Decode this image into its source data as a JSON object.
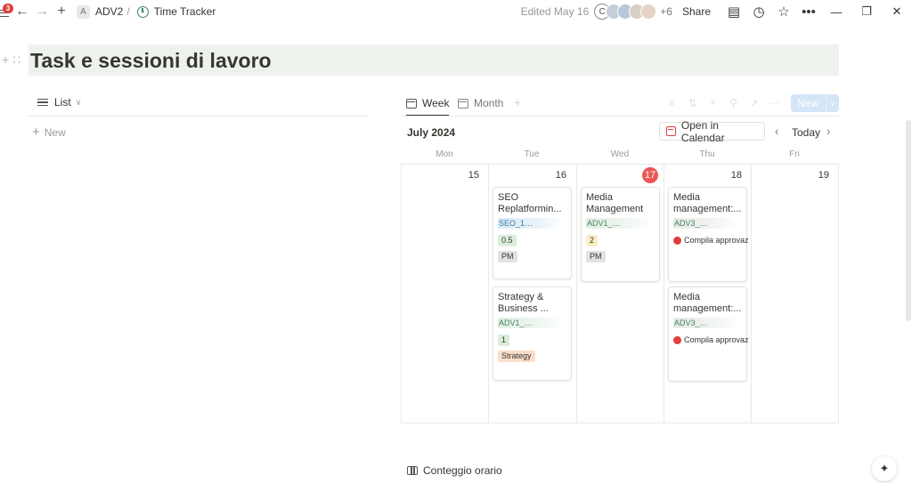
{
  "topbar": {
    "notification_count": "3",
    "workspace_badge": "A",
    "breadcrumb_workspace": "ADV2",
    "breadcrumb_separator": "/",
    "breadcrumb_page": "Time Tracker",
    "edited_text": "Edited May 16",
    "first_avatar_letter": "C",
    "extra_collaborators": "+6",
    "share_label": "Share",
    "icons": {
      "back": "←",
      "forward": "→",
      "add": "+",
      "comments": "▤",
      "history": "◷",
      "favorite": "☆",
      "more": "•••",
      "minimize": "—",
      "restore": "❐",
      "close": "✕"
    }
  },
  "page": {
    "title": "Task e sessioni di lavoro",
    "title_gutter": "+ ∷",
    "title_band_color": "#edf3ec"
  },
  "list_view": {
    "tab_label": "List",
    "new_label": "New",
    "plus": "+",
    "caret": "∨"
  },
  "calendar_view": {
    "tabs": [
      {
        "label": "Week",
        "active": true
      },
      {
        "label": "Month",
        "active": false
      }
    ],
    "tab_add": "+",
    "new_button": "New",
    "new_button_arrow": "∨",
    "month_label": "July 2024",
    "open_in_calendar": "Open in Calendar",
    "today_label": "Today",
    "prev": "‹",
    "next": "›",
    "day_names": [
      "Mon",
      "Tue",
      "Wed",
      "Thu",
      "Fri"
    ],
    "day_numbers": [
      "15",
      "16",
      "17",
      "18",
      "19"
    ],
    "today_index": 2,
    "cards": {
      "tue_1": {
        "title": "SEO Replatformin...",
        "code": "SEO_1…",
        "number": "0.5",
        "tag": "PM"
      },
      "tue_2": {
        "title": "Strategy & Business ...",
        "code": "ADV1_…",
        "number": "1",
        "tag": "Strategy"
      },
      "wed_1": {
        "title": "Media Management",
        "code": "ADV1_…",
        "number": "2",
        "tag": "PM"
      },
      "thu_1": {
        "title": "Media management:...",
        "code": "ADV3_…",
        "status": "Compila approvazione"
      },
      "thu_2": {
        "title": "Media management:...",
        "code": "ADV3_…",
        "status": "Compila approvazione"
      }
    }
  },
  "bottom": {
    "view_label": "Conteggio orario",
    "ai_icon": "✦"
  }
}
